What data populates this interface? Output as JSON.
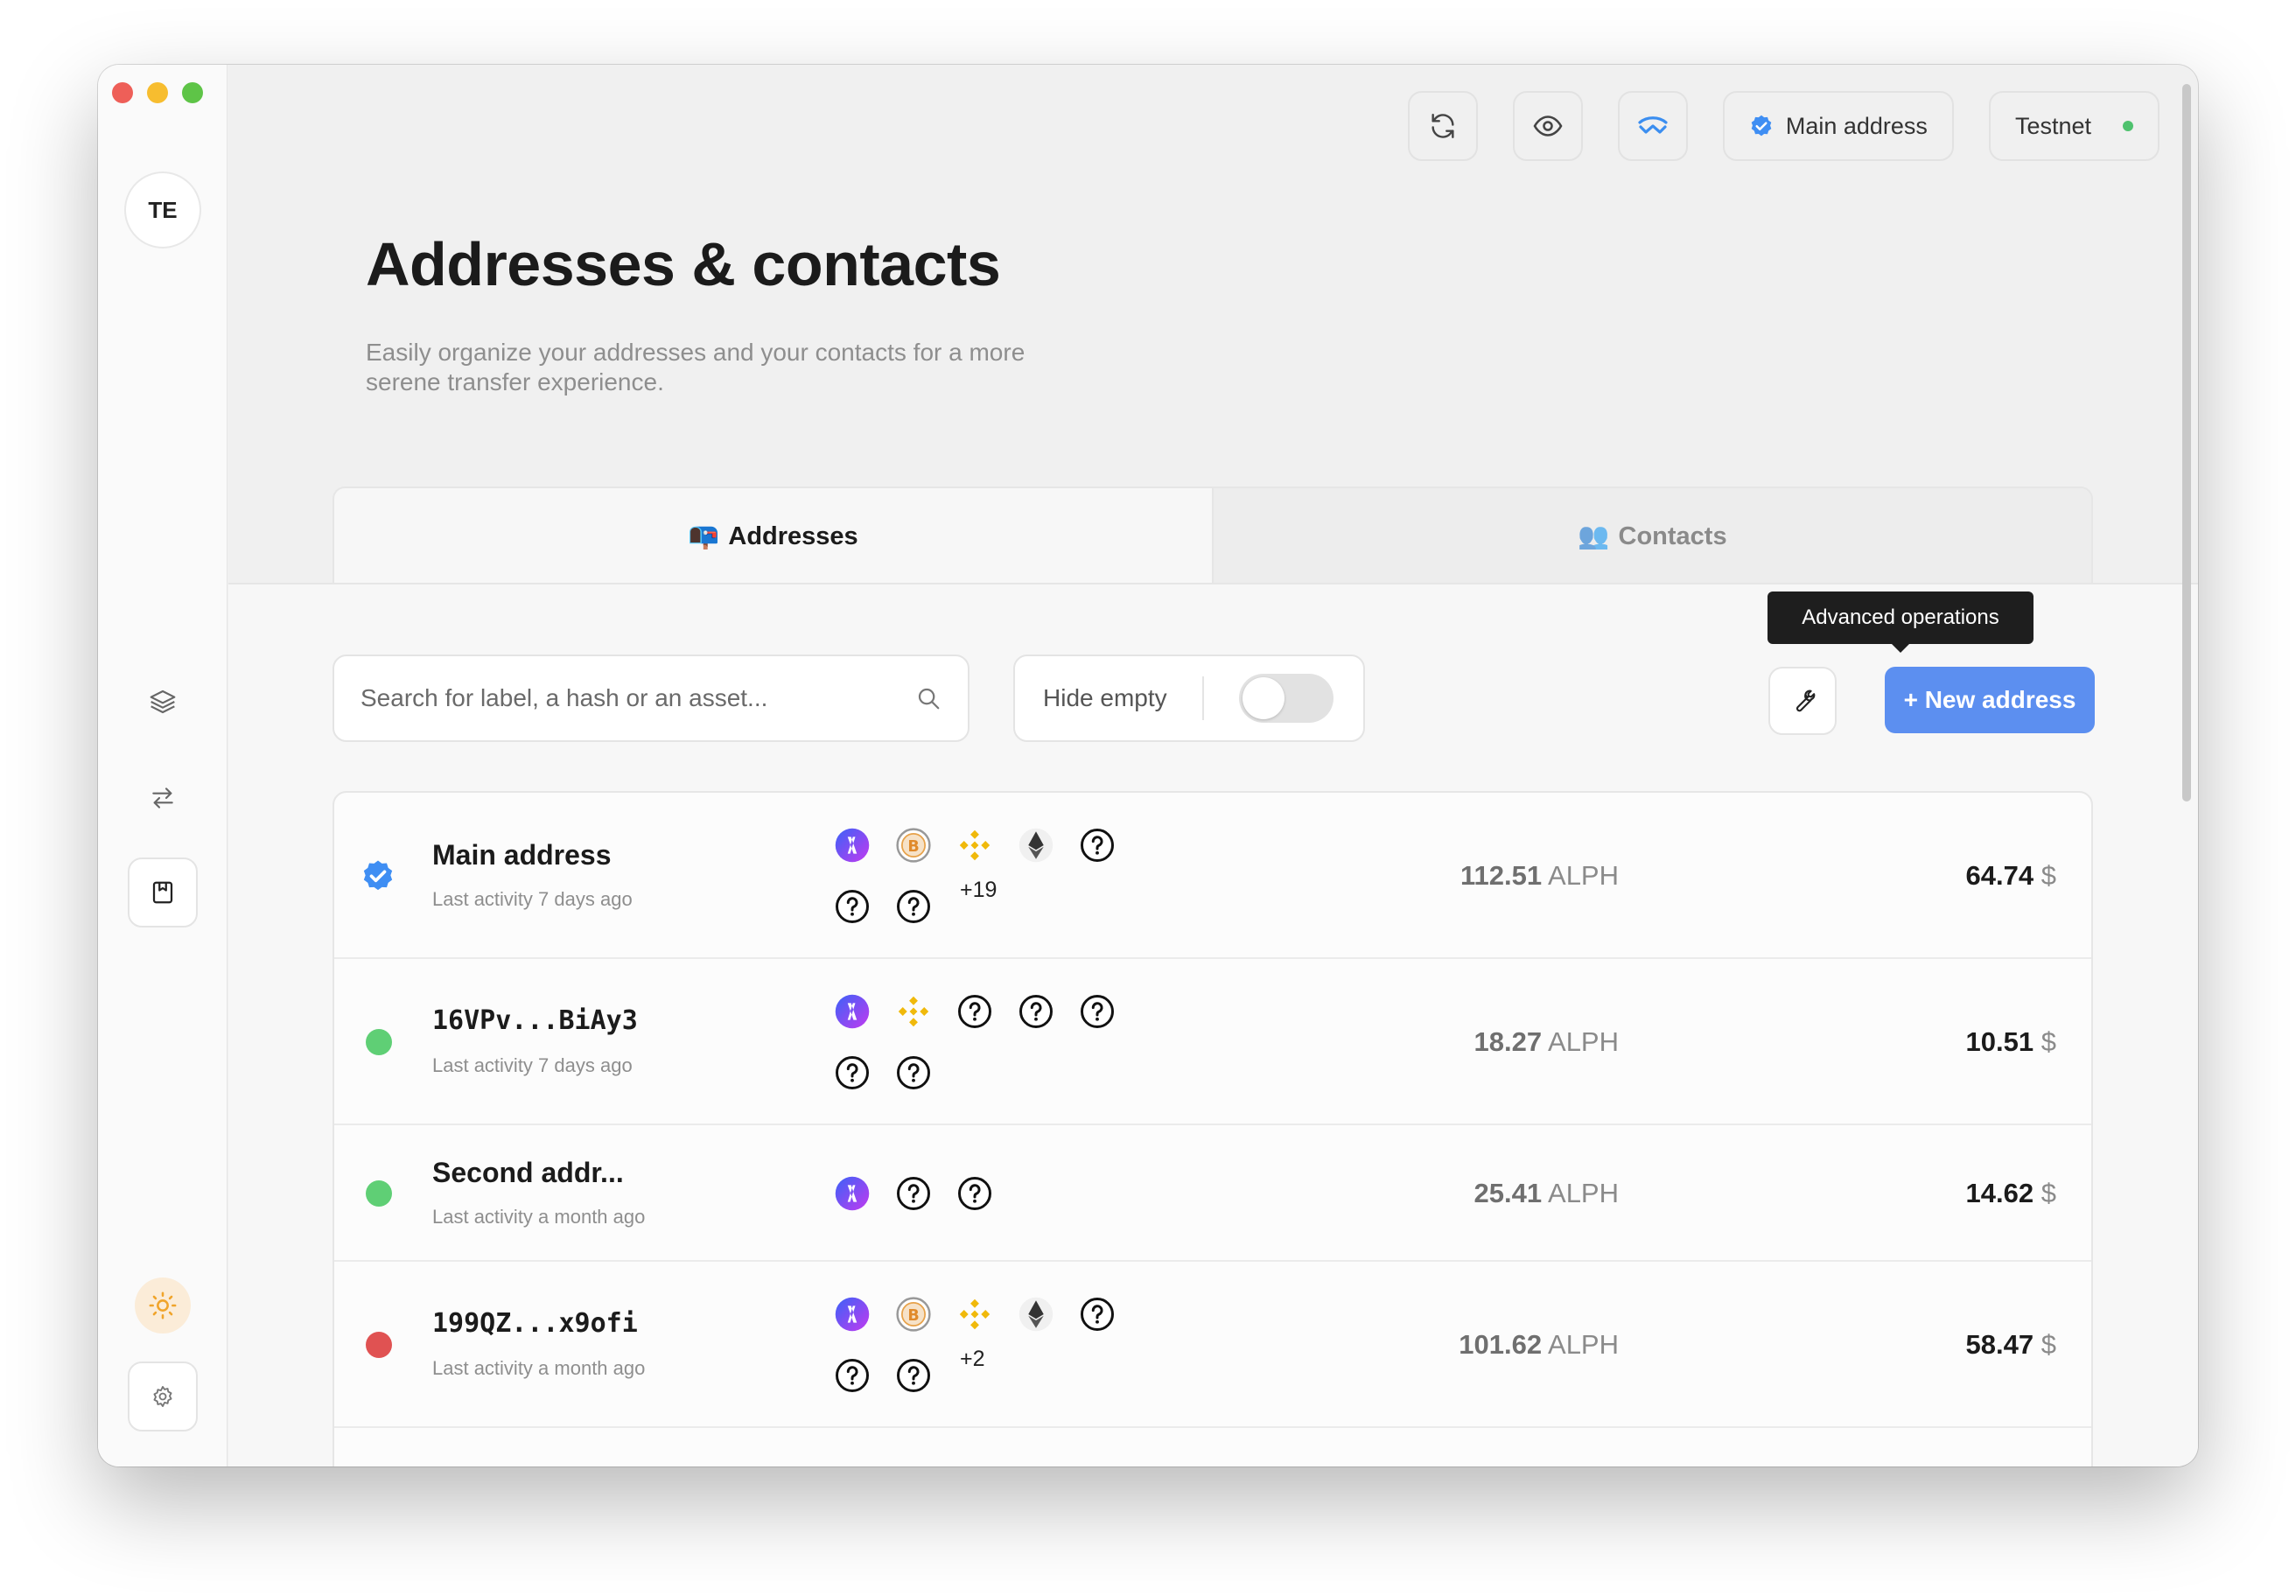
{
  "sidebar": {
    "avatar_initials": "TE"
  },
  "topbar": {
    "address_label": "Main address",
    "network_label": "Testnet",
    "network_dot_color": "#4fc26e"
  },
  "header": {
    "title": "Addresses & contacts",
    "subtitle": "Easily organize your addresses and your contacts for a more serene transfer experience."
  },
  "tabs": [
    {
      "emoji": "📭",
      "label": "Addresses",
      "active": true
    },
    {
      "emoji": "👥",
      "label": "Contacts",
      "active": false
    }
  ],
  "toolbar": {
    "search_placeholder": "Search for label, a hash or an asset...",
    "hide_empty_label": "Hide empty",
    "hide_empty_on": false,
    "advanced_tooltip": "Advanced operations",
    "new_address_label": "+ New address",
    "accent_color": "#5c8ff0"
  },
  "addresses": [
    {
      "name": "Main address",
      "status": "verified",
      "status_color": "#3f8ef3",
      "activity": "Last activity 7 days ago",
      "assets": [
        "alph-icon",
        "bitcoin-icon",
        "bnb-icon",
        "ethereum-icon",
        "unknown-asset-icon",
        "unknown-asset-icon",
        "unknown-asset-icon"
      ],
      "extra_assets": "+19",
      "alph_value": "112.51",
      "alph_unit": "ALPH",
      "usd_value": "64.74",
      "usd_unit": "$"
    },
    {
      "name": "16VPv...BiAy3",
      "status": "green",
      "status_color": "#5fcf75",
      "activity": "Last activity 7 days ago",
      "assets": [
        "alph-icon",
        "bnb-icon",
        "unknown-asset-icon",
        "unknown-asset-icon",
        "unknown-asset-icon",
        "unknown-asset-icon",
        "unknown-asset-icon"
      ],
      "extra_assets": "",
      "alph_value": "18.27",
      "alph_unit": "ALPH",
      "usd_value": "10.51",
      "usd_unit": "$"
    },
    {
      "name": "Second addr...",
      "status": "green",
      "status_color": "#5fcf75",
      "activity": "Last activity a month ago",
      "assets": [
        "alph-icon",
        "unknown-asset-icon",
        "unknown-asset-icon"
      ],
      "extra_assets": "",
      "alph_value": "25.41",
      "alph_unit": "ALPH",
      "usd_value": "14.62",
      "usd_unit": "$"
    },
    {
      "name": "199QZ...x9ofi",
      "status": "red",
      "status_color": "#e05252",
      "activity": "Last activity a month ago",
      "assets": [
        "alph-icon",
        "bitcoin-icon",
        "bnb-icon",
        "ethereum-icon",
        "unknown-asset-icon",
        "unknown-asset-icon",
        "unknown-asset-icon"
      ],
      "extra_assets": "+2",
      "alph_value": "101.62",
      "alph_unit": "ALPH",
      "usd_value": "58.47",
      "usd_unit": "$"
    }
  ]
}
